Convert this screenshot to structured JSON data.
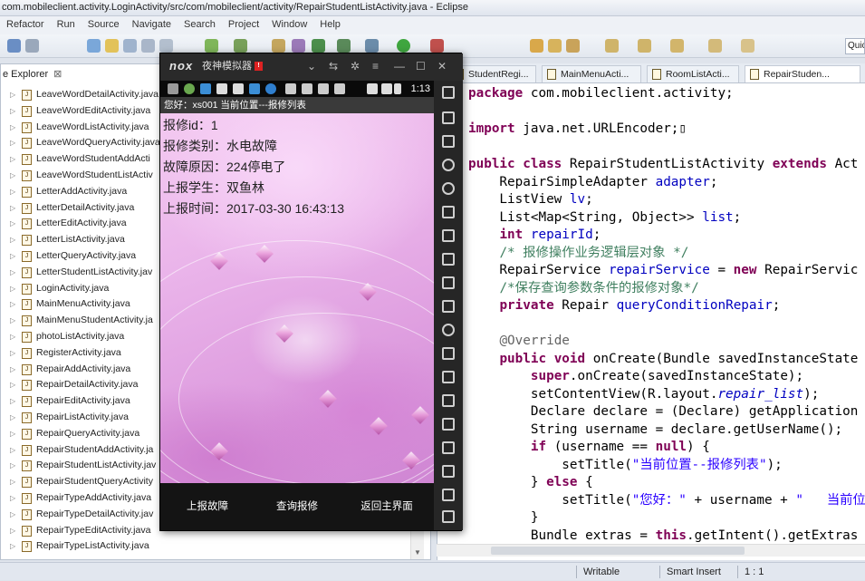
{
  "window": {
    "title": "com.mobileclient.activity.LoginActivity/src/com/mobileclient/activity/RepairStudentListActivity.java - Eclipse"
  },
  "menu": [
    "Refactor",
    "Run",
    "Source",
    "Navigate",
    "Search",
    "Project",
    "Window",
    "Help"
  ],
  "quick_access": "Quic",
  "explorer": {
    "tab_label": "e Explorer",
    "close": "⊠",
    "files": [
      "LeaveWordDetailActivity.java",
      "LeaveWordEditActivity.java",
      "LeaveWordListActivity.java",
      "LeaveWordQueryActivity.java",
      "LeaveWordStudentAddActi",
      "LeaveWordStudentListActiv",
      "LetterAddActivity.java",
      "LetterDetailActivity.java",
      "LetterEditActivity.java",
      "LetterListActivity.java",
      "LetterQueryActivity.java",
      "LetterStudentListActivity.jav",
      "LoginActivity.java",
      "MainMenuActivity.java",
      "MainMenuStudentActivity.ja",
      "photoListActivity.java",
      "RegisterActivity.java",
      "RepairAddActivity.java",
      "RepairDetailActivity.java",
      "RepairEditActivity.java",
      "RepairListActivity.java",
      "RepairQueryActivity.java",
      "RepairStudentAddActivity.ja",
      "RepairStudentListActivity.jav",
      "RepairStudentQueryActivity",
      "RepairTypeAddActivity.java",
      "RepairTypeDetailActivity.jav",
      "RepairTypeEditActivity.java",
      "RepairTypeListActivity.java"
    ]
  },
  "editor": {
    "tabs": [
      "StudentRegi...",
      "MainMenuActi...",
      "RoomListActi...",
      "RepairStuden..."
    ],
    "active_tab": 3
  },
  "status": {
    "writable": "Writable",
    "insert_mode": "Smart Insert",
    "position": "1 : 1"
  },
  "emulator": {
    "logo": "nox",
    "name": "夜神模拟器",
    "badge": "!",
    "time": "1:13",
    "app_title": "您好：xs001  当前位置---报修列表",
    "details": [
      "报修id：1",
      "报修类别：水电故障",
      "故障原因：224停电了",
      "上报学生：双鱼林",
      "上报时间：2017-03-30 16:43:13"
    ],
    "buttons": [
      "上报故障",
      "查询报修",
      "返回主界面"
    ]
  },
  "colors": {
    "keyword": "#7f0055",
    "field": "#0000c0",
    "comment": "#3f7f5f",
    "string": "#2a00ff"
  }
}
